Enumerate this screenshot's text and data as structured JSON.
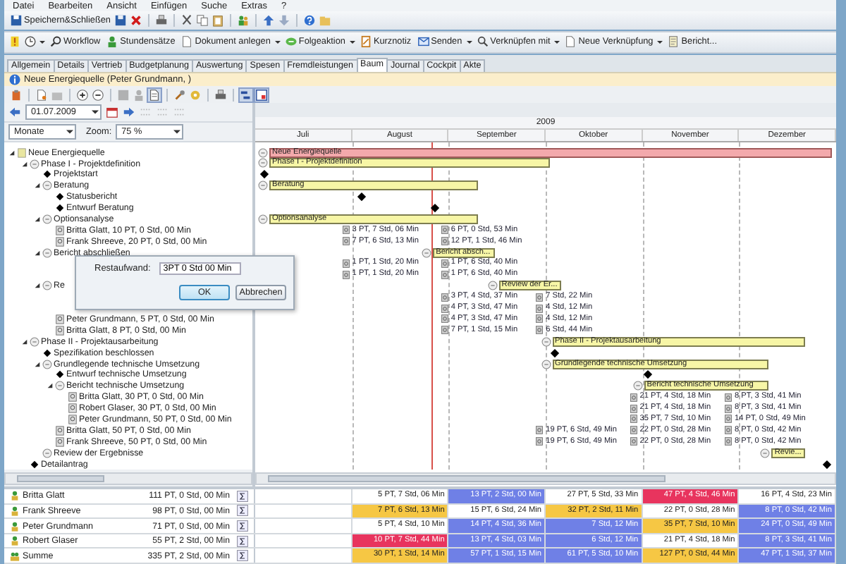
{
  "menu": [
    "Datei",
    "Bearbeiten",
    "Ansicht",
    "Einfügen",
    "Suche",
    "Extras",
    "?"
  ],
  "toolbar": {
    "save_close": "Speichern&Schließen"
  },
  "actions": [
    {
      "label": "Workflow",
      "dropdown": false
    },
    {
      "label": "Stundensätze",
      "dropdown": false
    },
    {
      "label": "Dokument anlegen",
      "dropdown": true
    },
    {
      "label": "Folgeaktion",
      "dropdown": true
    },
    {
      "label": "Kurznotiz",
      "dropdown": false
    },
    {
      "label": "Senden",
      "dropdown": true
    },
    {
      "label": "Verknüpfen mit",
      "dropdown": true
    },
    {
      "label": "Neue Verknüpfung",
      "dropdown": true
    },
    {
      "label": "Bericht...",
      "dropdown": false
    }
  ],
  "tabs": [
    {
      "label": "Allgemein",
      "selected": false
    },
    {
      "label": "Details",
      "selected": false
    },
    {
      "label": "Vertrieb",
      "selected": false
    },
    {
      "label": "Budgetplanung",
      "selected": false
    },
    {
      "label": "Auswertung",
      "selected": false
    },
    {
      "label": "Spesen",
      "selected": false
    },
    {
      "label": "Fremdleistungen",
      "selected": false
    },
    {
      "label": "Baum",
      "selected": true
    },
    {
      "label": "Journal",
      "selected": false
    },
    {
      "label": "Cockpit",
      "selected": false
    },
    {
      "label": "Akte",
      "selected": false
    }
  ],
  "info_bar": "Neue Energiequelle (Peter Grundmann, )",
  "date": "01.07.2009",
  "scale": "Monate",
  "zoom_label": "Zoom:",
  "zoom": "75 %",
  "timeline": {
    "year": "2009",
    "months": [
      "Juli",
      "August",
      "September",
      "Oktober",
      "November",
      "Dezember"
    ]
  },
  "tree": [
    {
      "kind": "project",
      "label": "Neue Energiequelle",
      "bar": "Neue Energiequelle",
      "expanded": true,
      "children": [
        {
          "kind": "phase",
          "label": "Phase I - Projektdefinition",
          "bar": "Phase I - Projektdefinition",
          "expanded": true,
          "children": [
            {
              "kind": "milestone",
              "label": "Projektstart"
            },
            {
              "kind": "phase",
              "label": "Beratung",
              "bar": "Beratung",
              "expanded": true,
              "children": [
                {
                  "kind": "milestone",
                  "label": "Statusbericht"
                },
                {
                  "kind": "milestone",
                  "label": "Entwurf Beratung"
                }
              ]
            },
            {
              "kind": "phase",
              "label": "Optionsanalyse",
              "bar": "Optionsanalyse",
              "expanded": true,
              "children": [
                {
                  "kind": "resource",
                  "label": "Britta Glatt, 10 PT, 0 Std, 00 Min",
                  "amounts": [
                    "3 PT, 7 Std, 06 Min",
                    "6 PT, 0 Std, 53 Min"
                  ]
                },
                {
                  "kind": "resource",
                  "label": "Frank Shreeve, 20 PT, 0 Std, 00 Min",
                  "amounts": [
                    "7 PT, 6 Std, 13 Min",
                    "12 PT, 1 Std, 46 Min"
                  ]
                }
              ]
            },
            {
              "kind": "phase",
              "label": "Bericht abschließen",
              "bar": "Bericht absch...",
              "expanded": true,
              "children": [
                {
                  "kind": "resource",
                  "amounts": [
                    "1 PT, 1 Std, 20 Min",
                    "1 PT, 6 Std, 40 Min"
                  ]
                },
                {
                  "kind": "resource",
                  "amounts": [
                    "1 PT, 1 Std, 20 Min",
                    "1 PT, 6 Std, 40 Min"
                  ]
                }
              ]
            },
            {
              "kind": "phase",
              "label": "Re",
              "bar": "Review der Er...",
              "expanded": true,
              "children": [
                {
                  "kind": "resource",
                  "amounts": [
                    "3 PT, 4 Std, 37 Min",
                    "7 Std, 22 Min"
                  ]
                },
                {
                  "kind": "resource",
                  "amounts": [
                    "4 PT, 3 Std, 47 Min",
                    "4 Std, 12 Min"
                  ]
                },
                {
                  "kind": "resource",
                  "label": "Peter Grundmann, 5 PT, 0 Std, 00 Min",
                  "amounts": [
                    "4 PT, 3 Std, 47 Min",
                    "4 Std, 12 Min"
                  ]
                },
                {
                  "kind": "resource",
                  "label": "Britta Glatt, 8 PT, 0 Std, 00 Min",
                  "amounts": [
                    "7 PT, 1 Std, 15 Min",
                    "6 Std, 44 Min"
                  ]
                }
              ]
            }
          ]
        },
        {
          "kind": "phase",
          "label": "Phase II - Projektausarbeitung",
          "bar": "Phase II - Projektausarbeitung",
          "expanded": true,
          "children": [
            {
              "kind": "milestone",
              "label": "Spezifikation beschlossen"
            },
            {
              "kind": "phase",
              "label": "Grundlegende technische Umsetzung",
              "bar": "Grundlegende technische Umsetzung",
              "expanded": true,
              "children": [
                {
                  "kind": "milestone",
                  "label": "Entwurf technische Umsetzung"
                },
                {
                  "kind": "phase",
                  "label": "Bericht technische Umsetzung",
                  "bar": "Bericht technische Umsetzung",
                  "expanded": true,
                  "children": [
                    {
                      "kind": "resource",
                      "label": "Britta Glatt, 30 PT, 0 Std, 00 Min",
                      "amounts": [
                        "21 PT, 4 Std, 18 Min",
                        "8 PT, 3 Std, 41 Min"
                      ]
                    },
                    {
                      "kind": "resource",
                      "label": "Robert Glaser, 30 PT, 0 Std, 00 Min",
                      "amounts": [
                        "21 PT, 4 Std, 18 Min",
                        "8 PT, 3 Std, 41 Min"
                      ]
                    },
                    {
                      "kind": "resource",
                      "label": "Peter Grundmann, 50 PT, 0 Std, 00 Min",
                      "amounts": [
                        "35 PT, 7 Std, 10 Min",
                        "14 PT, 0 Std, 49 Min"
                      ]
                    }
                  ]
                },
                {
                  "kind": "resource",
                  "label": "Britta Glatt, 50 PT, 0 Std, 00 Min",
                  "amounts": [
                    "19 PT, 6 Std, 49 Min",
                    "22 PT, 0 Std, 28 Min",
                    "8 PT, 0 Std, 42 Min"
                  ]
                },
                {
                  "kind": "resource",
                  "label": "Frank Shreeve, 50 PT, 0 Std, 00 Min",
                  "amounts": [
                    "19 PT, 6 Std, 49 Min",
                    "22 PT, 0 Std, 28 Min",
                    "8 PT, 0 Std, 42 Min"
                  ]
                }
              ]
            },
            {
              "kind": "phase",
              "label": "Review der Ergebnisse",
              "bar": "Revie..."
            }
          ]
        },
        {
          "kind": "milestone",
          "label": "Detailantrag"
        }
      ]
    }
  ],
  "dialog": {
    "label": "Restaufwand:",
    "value": "3PT 0 Std 00 Min",
    "buttons": [
      "OK",
      "Abbrechen"
    ]
  },
  "summary": [
    {
      "kind": "person",
      "name": "Britta Glatt",
      "total": "111 PT, 0 Std, 00 Min",
      "cells": [
        {
          "text": "5 PT, 7 Std, 06 Min",
          "color": "#ffffff"
        },
        {
          "text": "13 PT, 2 Std, 00 Min",
          "color": "#6f80e6"
        },
        {
          "text": "27 PT, 5 Std, 33 Min",
          "color": "#ffffff"
        },
        {
          "text": "47 PT, 4 Std, 46 Min",
          "color": "#e8345e"
        },
        {
          "text": "16 PT, 4 Std, 23 Min",
          "color": "#ffffff"
        }
      ]
    },
    {
      "kind": "person",
      "name": "Frank Shreeve",
      "total": "98 PT, 0 Std, 00 Min",
      "cells": [
        {
          "text": "7 PT, 6 Std, 13 Min",
          "color": "#f6c744"
        },
        {
          "text": "15 PT, 6 Std, 24 Min",
          "color": "#ffffff"
        },
        {
          "text": "32 PT, 2 Std, 11 Min",
          "color": "#f6c744"
        },
        {
          "text": "22 PT, 0 Std, 28 Min",
          "color": "#ffffff"
        },
        {
          "text": "8 PT, 0 Std, 42 Min",
          "color": "#6f80e6"
        }
      ]
    },
    {
      "kind": "person",
      "name": "Peter Grundmann",
      "total": "71 PT, 0 Std, 00 Min",
      "cells": [
        {
          "text": "5 PT, 4 Std, 10 Min",
          "color": "#ffffff"
        },
        {
          "text": "14 PT, 4 Std, 36 Min",
          "color": "#6f80e6"
        },
        {
          "text": "7 Std, 12 Min",
          "color": "#6f80e6"
        },
        {
          "text": "35 PT, 7 Std, 10 Min",
          "color": "#f6c744"
        },
        {
          "text": "24 PT, 0 Std, 49 Min",
          "color": "#6f80e6"
        }
      ]
    },
    {
      "kind": "person",
      "name": "Robert Glaser",
      "total": "55 PT, 2 Std, 00 Min",
      "cells": [
        {
          "text": "10 PT, 7 Std, 44 Min",
          "color": "#e8345e"
        },
        {
          "text": "13 PT, 4 Std, 03 Min",
          "color": "#6f80e6"
        },
        {
          "text": "6 Std, 12 Min",
          "color": "#6f80e6"
        },
        {
          "text": "21 PT, 4 Std, 18 Min",
          "color": "#ffffff"
        },
        {
          "text": "8 PT, 3 Std, 41 Min",
          "color": "#6f80e6"
        }
      ]
    },
    {
      "kind": "sum",
      "name": "Summe",
      "total": "335 PT, 2 Std, 00 Min",
      "cells": [
        {
          "text": "30 PT, 1 Std, 14 Min",
          "color": "#f6c744"
        },
        {
          "text": "57 PT, 1 Std, 15 Min",
          "color": "#6f80e6"
        },
        {
          "text": "61 PT, 5 Std, 10 Min",
          "color": "#6f80e6"
        },
        {
          "text": "127 PT, 0 Std, 44 Min",
          "color": "#f6c744"
        },
        {
          "text": "47 PT, 1 Std, 37 Min",
          "color": "#6f80e6"
        }
      ]
    }
  ]
}
